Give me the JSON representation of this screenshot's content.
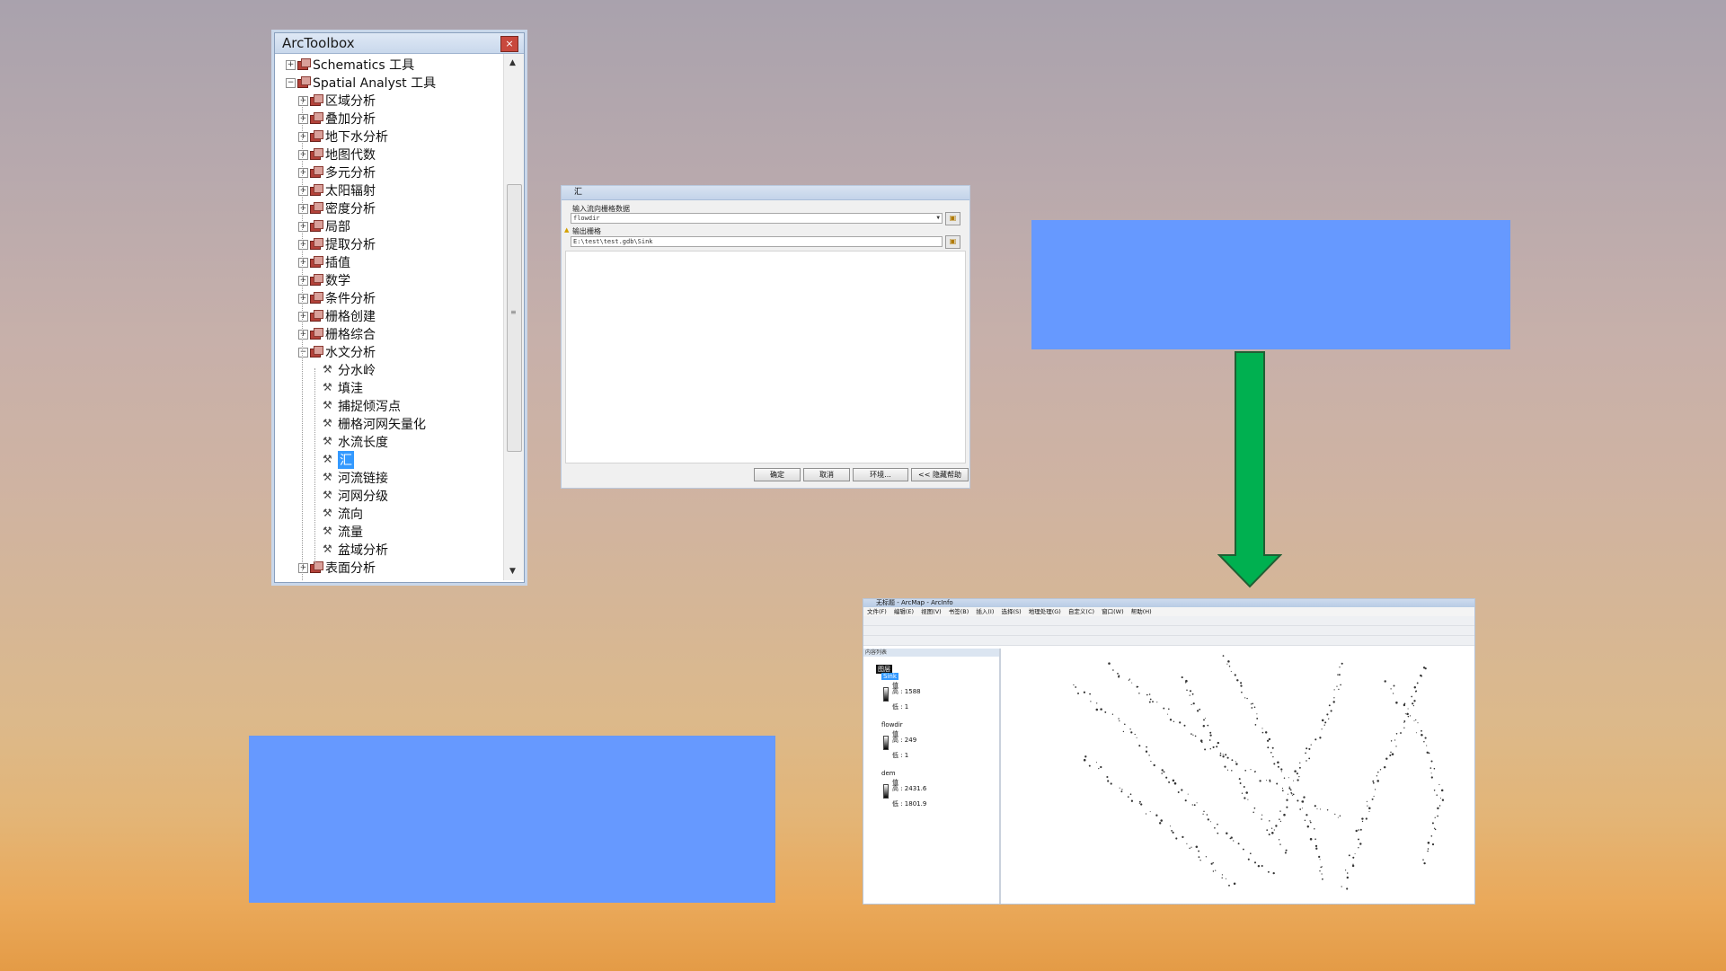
{
  "toolbox": {
    "title": "ArcToolbox",
    "close_label": "×",
    "items": [
      {
        "label": "Schematics 工具",
        "kind": "toolbox",
        "level": 0,
        "expanded": false
      },
      {
        "label": "Spatial Analyst 工具",
        "kind": "toolbox",
        "level": 0,
        "expanded": true
      },
      {
        "label": "区域分析",
        "kind": "toolset",
        "level": 1,
        "expanded": false
      },
      {
        "label": "叠加分析",
        "kind": "toolset",
        "level": 1,
        "expanded": false
      },
      {
        "label": "地下水分析",
        "kind": "toolset",
        "level": 1,
        "expanded": false
      },
      {
        "label": "地图代数",
        "kind": "toolset",
        "level": 1,
        "expanded": false
      },
      {
        "label": "多元分析",
        "kind": "toolset",
        "level": 1,
        "expanded": false
      },
      {
        "label": "太阳辐射",
        "kind": "toolset",
        "level": 1,
        "expanded": false
      },
      {
        "label": "密度分析",
        "kind": "toolset",
        "level": 1,
        "expanded": false
      },
      {
        "label": "局部",
        "kind": "toolset",
        "level": 1,
        "expanded": false
      },
      {
        "label": "提取分析",
        "kind": "toolset",
        "level": 1,
        "expanded": false
      },
      {
        "label": "插值",
        "kind": "toolset",
        "level": 1,
        "expanded": false
      },
      {
        "label": "数学",
        "kind": "toolset",
        "level": 1,
        "expanded": false
      },
      {
        "label": "条件分析",
        "kind": "toolset",
        "level": 1,
        "expanded": false
      },
      {
        "label": "栅格创建",
        "kind": "toolset",
        "level": 1,
        "expanded": false
      },
      {
        "label": "栅格综合",
        "kind": "toolset",
        "level": 1,
        "expanded": false
      },
      {
        "label": "水文分析",
        "kind": "toolset",
        "level": 1,
        "expanded": true
      },
      {
        "label": "分水岭",
        "kind": "tool",
        "level": 2
      },
      {
        "label": "填洼",
        "kind": "tool",
        "level": 2
      },
      {
        "label": "捕捉倾泻点",
        "kind": "tool",
        "level": 2
      },
      {
        "label": "栅格河网矢量化",
        "kind": "tool",
        "level": 2
      },
      {
        "label": "水流长度",
        "kind": "tool",
        "level": 2
      },
      {
        "label": "汇",
        "kind": "tool",
        "level": 2,
        "selected": true
      },
      {
        "label": "河流链接",
        "kind": "tool",
        "level": 2
      },
      {
        "label": "河网分级",
        "kind": "tool",
        "level": 2
      },
      {
        "label": "流向",
        "kind": "tool",
        "level": 2
      },
      {
        "label": "流量",
        "kind": "tool",
        "level": 2
      },
      {
        "label": "盆域分析",
        "kind": "tool",
        "level": 2
      },
      {
        "label": "表面分析",
        "kind": "toolset",
        "level": 1,
        "expanded": false
      }
    ]
  },
  "dialog": {
    "title": "汇",
    "input_label": "输入流向栅格数据",
    "input_value": "flowdir",
    "output_label": "输出栅格",
    "output_value": "E:\\test\\test.gdb\\Sink",
    "buttons": {
      "ok": "确定",
      "cancel": "取消",
      "env": "环境...",
      "hide_help": "<< 隐藏帮助"
    }
  },
  "arcmap": {
    "title": "无标题 - ArcMap - ArcInfo",
    "menu": [
      "文件(F)",
      "编辑(E)",
      "视图(V)",
      "书签(B)",
      "插入(I)",
      "选择(S)",
      "地理处理(G)",
      "自定义(C)",
      "窗口(W)",
      "帮助(H)"
    ],
    "toc_title": "内容列表",
    "layers_group": "图层",
    "layers": [
      {
        "name": "Sink",
        "value_label": "值",
        "high": "高 : 1588",
        "low": "低 : 1"
      },
      {
        "name": "flowdir",
        "value_label": "值",
        "high": "高 : 249",
        "low": "低 : 1"
      },
      {
        "name": "dem",
        "value_label": "值",
        "high": "高 : 2431.6",
        "low": "低 : 1801.9"
      }
    ]
  },
  "colors": {
    "blue_box": "#6699ff",
    "arrow_green": "#00b050",
    "selection": "#3399ff"
  }
}
